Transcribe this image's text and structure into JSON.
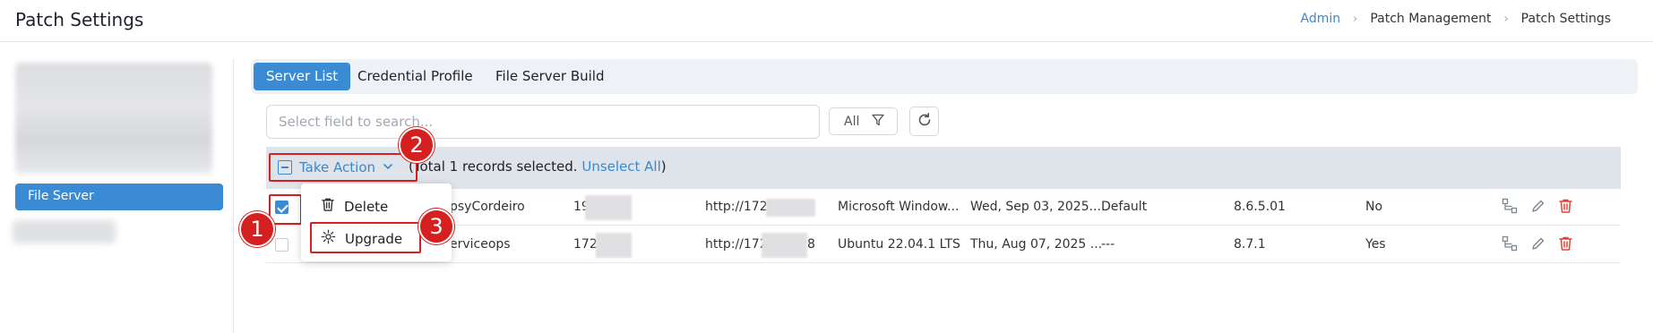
{
  "header": {
    "title": "Patch Settings",
    "breadcrumb": [
      "Admin",
      "Patch Management",
      "Patch Settings"
    ],
    "separator": "›"
  },
  "sidebar": {
    "active_item": "File Server"
  },
  "tabs": [
    {
      "label": "Server List",
      "active": true
    },
    {
      "label": "Credential Profile",
      "active": false
    },
    {
      "label": "File Server Build",
      "active": false
    }
  ],
  "search": {
    "placeholder": "Select field to search...",
    "value": ""
  },
  "filter": {
    "label": "All"
  },
  "selection": {
    "take_action_label": "Take Action",
    "open_paren": "(",
    "summary": "Total 1 records selected.",
    "unselect_label": "Unselect All",
    "close_paren": ")"
  },
  "menu": {
    "items": [
      {
        "label": "Delete",
        "icon": "trash-icon"
      },
      {
        "label": "Upgrade",
        "icon": "gear-cog-icon"
      }
    ]
  },
  "rows": [
    {
      "checked": true,
      "name": "psyCordeiro",
      "ip": "19",
      "url": "http://172.",
      "os": "Microsoft Window...",
      "date": "Wed, Sep 03, 2025...",
      "profile": "Default",
      "version": "8.6.5.01",
      "flag": "No"
    },
    {
      "checked": false,
      "name": "erviceops",
      "ip": "172",
      "url": "http://172",
      "url_tail": "8",
      "os": "Ubuntu 22.04.1 LTS",
      "date": "Thu, Aug 07, 2025 ...",
      "profile": "---",
      "version": "8.7.1",
      "flag": "Yes"
    }
  ],
  "steps": [
    "1",
    "2",
    "3"
  ],
  "colors": {
    "accent": "#3b8ad4",
    "link": "#3a88cf",
    "highlight": "#d61f1f",
    "delete": "#e0433b"
  }
}
